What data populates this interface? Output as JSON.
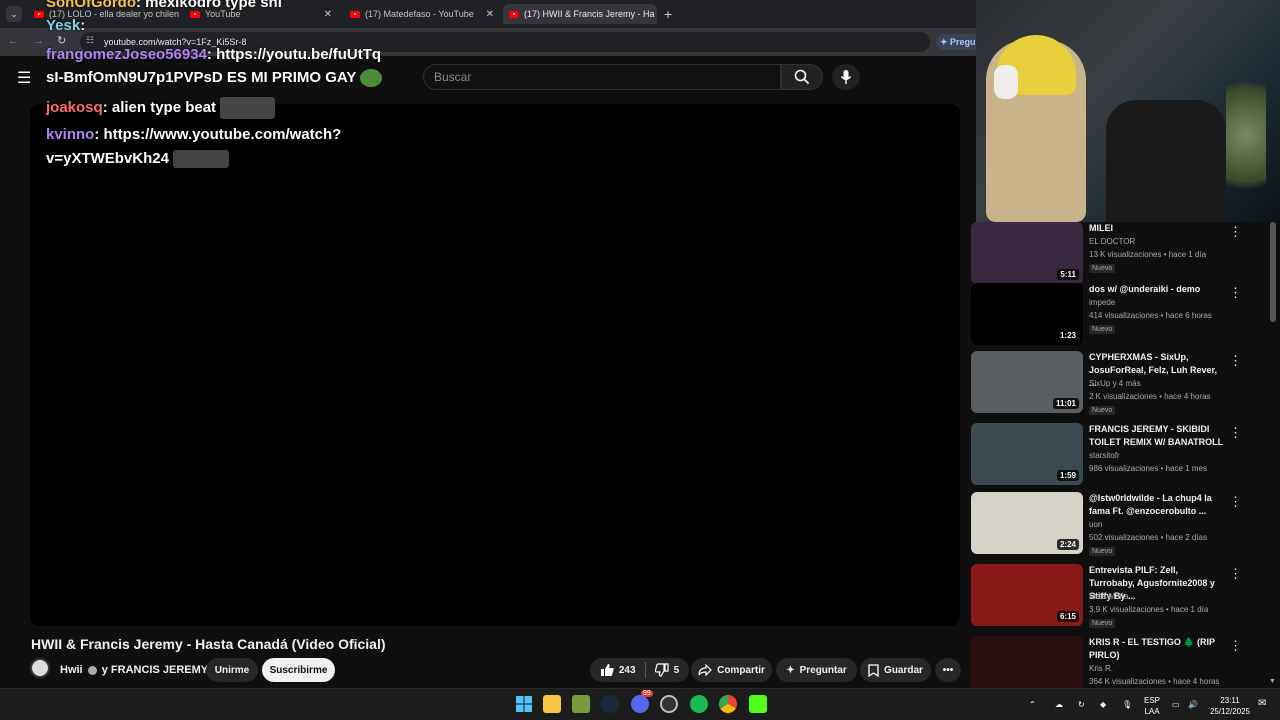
{
  "browser": {
    "tabs": [
      {
        "label": "(17) LOLO - ella dealer yo chilen"
      },
      {
        "label": "YouTube"
      },
      {
        "label": "(17) Matedefaso - YouTube"
      },
      {
        "label": "(17) HWII & Francis Jeremy - Ha"
      }
    ],
    "url": "youtube.com/watch?v=1Fz_Ki5Sr-8",
    "ask_label": "Pregu"
  },
  "search": {
    "placeholder": "Buscar"
  },
  "chat": [
    {
      "user": "SonOfGordo",
      "text": ": mexikodro type shi"
    },
    {
      "user": "Yesk",
      "text": ":"
    },
    {
      "user": "frangomezJoseo56934",
      "text": ": https://youtu.be/fuUtTq"
    },
    {
      "user": "",
      "text": "sI-BmfOmN9U7p1PVPsD ES MI PRIMO GAY"
    },
    {
      "user": "joakosq",
      "text": ": alien type beat"
    },
    {
      "user": "kvinno",
      "text": ": https://www.youtube.com/watch?"
    },
    {
      "user": "",
      "text": "v=yXTWEbvKh24"
    }
  ],
  "video": {
    "title": "HWII & Francis Jeremy - Hasta Canadá (Video Oficial)",
    "channel": "Hwii",
    "channel_joiner": "y FRANCIS JEREMY",
    "join_label": "Unirme",
    "subscribe_label": "Suscribirme",
    "likes": "243",
    "dislikes": "5",
    "share_label": "Compartir",
    "ask_label": "Preguntar",
    "save_label": "Guardar"
  },
  "recommendations": [
    {
      "title": "MILEI",
      "channel": "EL DOCTOR",
      "verified": true,
      "stats": "13 K visualizaciones • hace 1 día",
      "badge": "Nuevo",
      "duration": "5:11",
      "thumb_color": "#3a2740"
    },
    {
      "title": "dos w/ @underaiki - demo",
      "channel": "impede",
      "verified": true,
      "stats": "414 visualizaciones • hace 6 horas",
      "badge": "Nuevo",
      "duration": "1:23",
      "thumb_color": "#000000"
    },
    {
      "title": "CYPHERXMAS - SixUp, JosuForReal, Felz, Luh Rever, ...",
      "channel": "SixUp y 4 más",
      "verified": false,
      "stats": "2 K visualizaciones • hace 4 horas",
      "badge": "Nuevo",
      "duration": "11:01",
      "thumb_color": "#5a5e63"
    },
    {
      "title": "FRANCIS JEREMY - SKIBIDI TOILET REMIX W/ BANATROLL",
      "channel": "starsitofr",
      "verified": false,
      "stats": "986 visualizaciones • hace 1 mes",
      "badge": "",
      "duration": "1:59",
      "thumb_color": "#3c4a52"
    },
    {
      "title": "@lstw0rldwilde  - La chup4 la fama Ft. @enzocerobulto ...",
      "channel": "uon",
      "verified": false,
      "stats": "502 visualizaciones • hace 2 días",
      "badge": "Nuevo",
      "duration": "2:24",
      "thumb_color": "#d7d2c8"
    },
    {
      "title": "Entrevista PILF: Zell, Turrobaby, Agusfornite2008 y Stiffy By ...",
      "channel": "Mala Maña",
      "verified": false,
      "stats": "3,9 K visualizaciones • hace 1 día",
      "badge": "Nuevo",
      "duration": "6:15",
      "thumb_color": "#8a1a1a"
    },
    {
      "title": "KRIS R - EL TESTIGO 🌲 (RIP PIRLO)",
      "channel": "Kris R.",
      "verified": true,
      "stats": "364 K visualizaciones • hace 4 horas",
      "badge": "",
      "duration": "",
      "thumb_color": "#2a1010"
    }
  ],
  "taskbar": {
    "lang": "ESP",
    "layout": "LAA",
    "time": "23:11",
    "date": "25/12/2025",
    "discord_badge": "99"
  }
}
